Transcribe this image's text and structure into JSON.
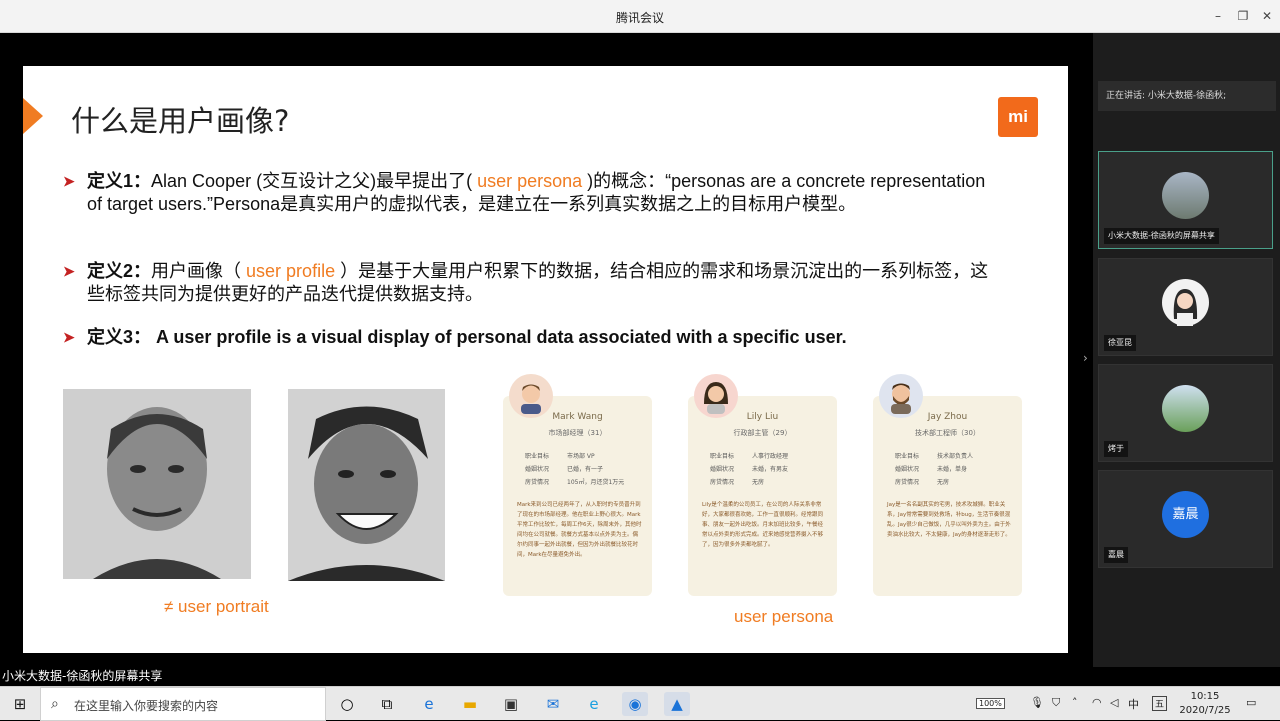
{
  "window": {
    "title": "腾讯会议",
    "min_label": "–",
    "max_label": "❐",
    "close_label": "✕"
  },
  "slide": {
    "heading": "什么是用户画像?",
    "logo_text": "mi",
    "def1": {
      "label": "定义1：",
      "pre": "Alan Cooper (交互设计之父)最早提出了( ",
      "highlight": "user persona",
      "post": " )的概念：“personas are a concrete representation of target users.”Persona是真实用户的虚拟代表，是建立在一系列真实数据之上的目标用户模型。"
    },
    "def2": {
      "label": "定义2：",
      "pre": "用户画像（ ",
      "highlight": "user profile",
      "post": " ）是基于大量用户积累下的数据，结合相应的需求和场景沉淀出的一系列标签，这些标签共同为提供更好的产品迭代提供数据支持。"
    },
    "def3": {
      "label": "定义3：",
      "text": " A user profile is a visual display of personal data associated with a specific user."
    },
    "caption_portrait": "≠ user portrait",
    "caption_persona": "user persona",
    "cards": [
      {
        "name": "Mark Wang",
        "role": "市场部经理（31）",
        "r1k": "职业目标",
        "r1v": "市场部 VP",
        "r2k": "婚姻状况",
        "r2v": "已婚，有一子",
        "r3k": "房贷情况",
        "r3v": "105㎡，月还贷1万元",
        "bio": "Mark来到公司已经两年了，从入职时的专员晋升到了现在的市场部经理。他在职业上野心很大。Mark平常工作比较忙，每周工作6天，除周末外，其他时间均在公司就餐。就餐方式基本以点外卖为主。偶尔约同事一起外出就餐，但因为外出就餐比较花时间，Mark在尽量避免外出。"
      },
      {
        "name": "Lily Liu",
        "role": "行政部主管（29）",
        "r1k": "职业目标",
        "r1v": "人事行政经理",
        "r2k": "婚姻状况",
        "r2v": "未婚，有男友",
        "r3k": "房贷情况",
        "r3v": "无房",
        "bio": "Lily是个温柔的公司员工，在公司的人际关系非常好，大家都很喜欢她，工作一直很顺利。经常跟同事、朋友一起外出吃饭。月末加班比较多，午餐经常以点外卖的形式完成。近来她感觉营养摄入不够了，因为很多外卖都吃腻了。"
      },
      {
        "name": "Jay Zhou",
        "role": "技术部工程师（30）",
        "r1k": "职业目标",
        "r1v": "技术部负责人",
        "r2k": "婚姻状况",
        "r2v": "未婚，单身",
        "r3k": "房贷情况",
        "r3v": "无房",
        "bio": "Jay是一名名副其实的宅男，技术攻城狮。职业关系，Jay常常需要到处救场，补bug，生活节奏很混乱。Jay很少自己做饭，几乎以叫外卖为主。由于外卖油水比较大，不太健康，Jay的身材逐渐走形了。"
      }
    ]
  },
  "sidebar": {
    "speaking": "正在讲话: 小米大数据-徐函秋;",
    "participants": [
      {
        "name": "小米大数据-徐函秋的屏幕共享",
        "initial": ""
      },
      {
        "name": "徐亚昆",
        "initial": ""
      },
      {
        "name": "烤于",
        "initial": ""
      },
      {
        "name": "嘉晨",
        "initial": "嘉晨"
      }
    ]
  },
  "share_label": "小米大数据-徐函秋的屏幕共享",
  "taskbar": {
    "search_placeholder": "在这里输入你要搜索的内容",
    "battery": "100%",
    "ime": "中",
    "ime2": "五",
    "time": "10:15",
    "date": "2020/7/25"
  }
}
